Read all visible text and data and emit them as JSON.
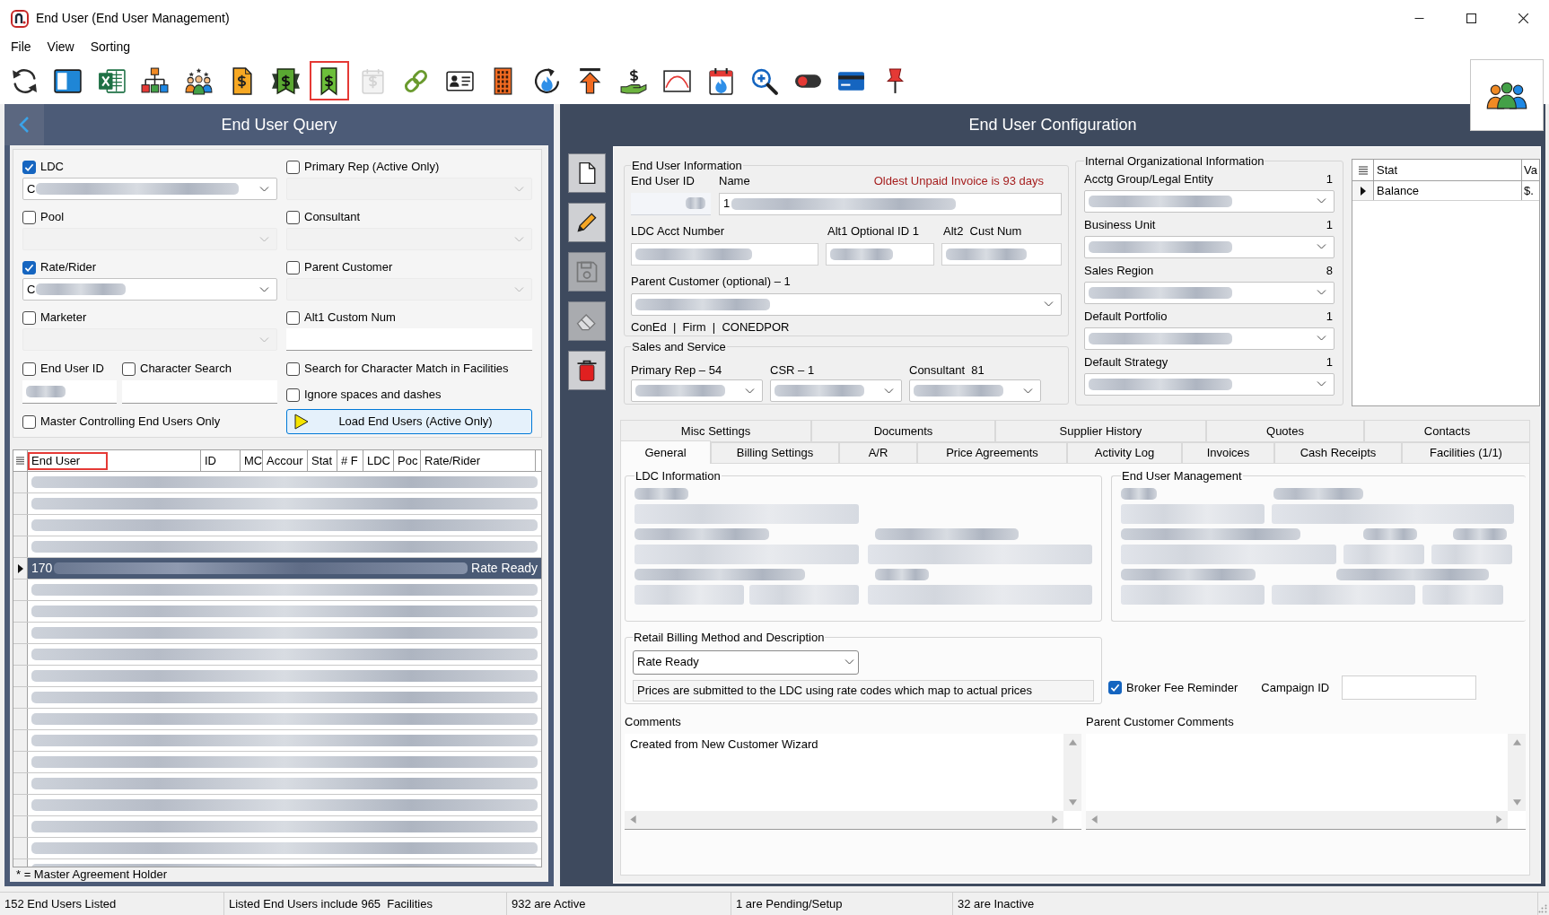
{
  "window": {
    "title": "End User (End User Management)"
  },
  "menu": [
    "File",
    "View",
    "Sorting"
  ],
  "toolbar": [
    {
      "kind": "refresh",
      "highlighted": false,
      "disabled": false
    },
    {
      "kind": "layout",
      "highlighted": false,
      "disabled": false
    },
    {
      "kind": "spreadsheet",
      "highlighted": false,
      "disabled": false
    },
    {
      "kind": "hierarchy",
      "highlighted": false,
      "disabled": false
    },
    {
      "kind": "team",
      "highlighted": false,
      "disabled": false
    },
    {
      "kind": "invoice",
      "highlighted": false,
      "disabled": false
    },
    {
      "kind": "ribbon",
      "highlighted": false,
      "disabled": false
    },
    {
      "kind": "bookmark",
      "highlighted": true,
      "disabled": false
    },
    {
      "kind": "calendar",
      "highlighted": false,
      "disabled": true
    },
    {
      "kind": "link",
      "highlighted": false,
      "disabled": false
    },
    {
      "kind": "card",
      "highlighted": false,
      "disabled": false
    },
    {
      "kind": "building",
      "highlighted": false,
      "disabled": false
    },
    {
      "kind": "flame",
      "highlighted": false,
      "disabled": false
    },
    {
      "kind": "upload",
      "highlighted": false,
      "disabled": false
    },
    {
      "kind": "payment",
      "highlighted": false,
      "disabled": false
    },
    {
      "kind": "chart",
      "highlighted": false,
      "disabled": false
    },
    {
      "kind": "gasdate",
      "highlighted": false,
      "disabled": false
    },
    {
      "kind": "zoom",
      "highlighted": false,
      "disabled": false
    },
    {
      "kind": "toggle",
      "highlighted": false,
      "disabled": false
    },
    {
      "kind": "credit",
      "highlighted": false,
      "disabled": false
    },
    {
      "kind": "pin",
      "highlighted": false,
      "disabled": false
    }
  ],
  "query": {
    "title": "End User Query",
    "filters": [
      {
        "label": "LDC",
        "checked": true,
        "kind": "combo",
        "value": "C",
        "blurred": true,
        "disabled": false
      },
      {
        "label": "Primary Rep (Active Only)",
        "checked": false,
        "kind": "combo",
        "blurred": false,
        "disabled": true
      },
      {
        "label": "Pool",
        "checked": false,
        "kind": "combo",
        "blurred": false,
        "disabled": true
      },
      {
        "label": "Consultant",
        "checked": false,
        "kind": "combo",
        "blurred": false,
        "disabled": true
      },
      {
        "label": "Rate/Rider",
        "checked": true,
        "kind": "combo",
        "value": "C",
        "blurred": true,
        "disabled": false
      },
      {
        "label": "Parent Customer",
        "checked": false,
        "kind": "combo",
        "blurred": false,
        "disabled": true
      },
      {
        "label": "Marketer",
        "checked": false,
        "kind": "combo",
        "blurred": false,
        "disabled": true
      },
      {
        "label": "Alt1 Custom Num",
        "checked": false,
        "kind": "text",
        "blurred": false,
        "disabled": false
      }
    ],
    "end_user_id": {
      "label": "End User ID",
      "checked": false,
      "blurred": true
    },
    "character_search": {
      "label": "Character Search",
      "checked": false
    },
    "options": [
      {
        "label": "Search for Character Match in Facilities",
        "checked": false
      },
      {
        "label": "Ignore spaces and dashes",
        "checked": false
      }
    ],
    "master_only": {
      "label": "Master Controlling End Users Only",
      "checked": false
    },
    "load_button": "Load End Users (Active Only)"
  },
  "grid": {
    "columns": [
      {
        "label": "End User",
        "highlighted": true
      },
      {
        "label": "ID",
        "highlighted": false
      },
      {
        "label": "MC",
        "highlighted": false
      },
      {
        "label": "Accour",
        "highlighted": false
      },
      {
        "label": "Stat",
        "highlighted": false
      },
      {
        "label": "# F",
        "highlighted": false
      },
      {
        "label": "LDC",
        "highlighted": false
      },
      {
        "label": "Poc",
        "highlighted": false
      },
      {
        "label": "Rate/Rider",
        "highlighted": false
      }
    ],
    "rows": [
      {
        "selected": false
      },
      {
        "selected": false
      },
      {
        "selected": false
      },
      {
        "selected": false
      },
      {
        "selected": true,
        "end_user": "170",
        "rate_rider": "Rate Ready"
      },
      {
        "selected": false
      },
      {
        "selected": false
      },
      {
        "selected": false
      },
      {
        "selected": false
      },
      {
        "selected": false
      },
      {
        "selected": false
      },
      {
        "selected": false
      },
      {
        "selected": false
      },
      {
        "selected": false
      },
      {
        "selected": false
      },
      {
        "selected": false
      },
      {
        "selected": false
      },
      {
        "selected": false
      },
      {
        "selected": false
      }
    ],
    "footnote": "* = Master Agreement Holder"
  },
  "config": {
    "title": "End User Configuration",
    "tools": [
      {
        "kind": "new",
        "disabled": false
      },
      {
        "kind": "edit",
        "disabled": false
      },
      {
        "kind": "save",
        "disabled": true
      },
      {
        "kind": "erase",
        "disabled": true
      },
      {
        "kind": "delete",
        "disabled": false
      }
    ],
    "info": {
      "title": "End User Information",
      "end_user_id_label": "End User ID",
      "name_label": "Name",
      "alert": "Oldest Unpaid Invoice is 93 days",
      "name_value": "1",
      "ldc_acct_label": "LDC Acct Number",
      "alt1_label": "Alt1 Optional ID 1",
      "alt2_label": "Alt2  Cust Num",
      "parent_label": "Parent Customer (optional) – 1",
      "summary": "ConEd  |  Firm  |  CONEDPOR"
    },
    "sales": {
      "title": "Sales and Service",
      "fields": [
        "Primary Rep – 54",
        "CSR – 1",
        "Consultant  81"
      ]
    },
    "internal": {
      "title": "Internal Organizational Information",
      "fields": [
        {
          "label": "Acctg Group/Legal Entity",
          "count": "1"
        },
        {
          "label": "Business Unit",
          "count": "1"
        },
        {
          "label": "Sales Region",
          "count": "8"
        },
        {
          "label": "Default Portfolio",
          "count": "1"
        },
        {
          "label": "Default Strategy",
          "count": "1"
        }
      ]
    },
    "stats": {
      "columns": [
        "Stat",
        "Va"
      ],
      "rows": [
        {
          "selected": true,
          "stat": "Balance",
          "value": "$."
        }
      ]
    },
    "tabs": {
      "back": [
        {
          "label": "Misc Settings",
          "selected": false
        },
        {
          "label": "Documents",
          "selected": false
        },
        {
          "label": "Supplier History",
          "selected": false
        },
        {
          "label": "Quotes",
          "selected": false
        },
        {
          "label": "Contacts",
          "selected": false
        }
      ],
      "front": [
        {
          "label": "General",
          "selected": true
        },
        {
          "label": "Billing Settings",
          "selected": false
        },
        {
          "label": "A/R",
          "selected": false
        },
        {
          "label": "Price Agreements",
          "selected": false
        },
        {
          "label": "Activity Log",
          "selected": false
        },
        {
          "label": "Invoices",
          "selected": false
        },
        {
          "label": "Cash Receipts",
          "selected": false
        },
        {
          "label": "Facilities (1/1)",
          "selected": false
        }
      ]
    },
    "general": {
      "ldc_title": "LDC Information",
      "management_title": "End User Management",
      "retail": {
        "title": "Retail Billing Method and Description",
        "method": "Rate Ready",
        "description": "Prices are submitted to the LDC using rate codes which map to actual prices"
      },
      "broker": {
        "label": "Broker Fee Reminder",
        "checked": true
      },
      "campaign_label": "Campaign ID",
      "comments": {
        "label": "Comments",
        "value": "Created from New Customer Wizard"
      },
      "parent_comments": {
        "label": "Parent Customer Comments"
      }
    }
  },
  "status_bar": [
    "152 End Users Listed",
    "Listed End Users include 965  Facilities",
    "932 are Active",
    "1 are Pending/Setup",
    "32 are Inactive"
  ]
}
